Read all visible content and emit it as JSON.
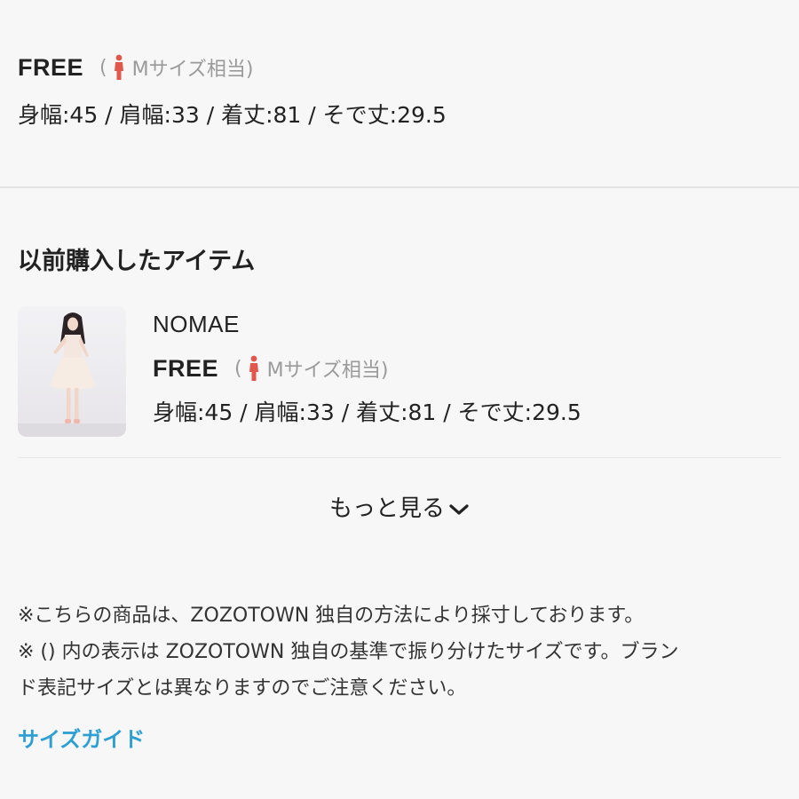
{
  "top_size": {
    "name": "FREE",
    "open_paren": "(",
    "equivalent": "Mサイズ相当)",
    "measurements": "身幅:45 / 肩幅:33 / 着丈:81 / そで丈:29.5"
  },
  "purchased": {
    "title": "以前購入したアイテム",
    "items": [
      {
        "brand": "NOMAE",
        "size_name": "FREE",
        "open_paren": "(",
        "equivalent": "Mサイズ相当)",
        "measurements": "身幅:45 / 肩幅:33 / 着丈:81 / そで丈:29.5"
      }
    ]
  },
  "more_label": "もっと見る",
  "notes": {
    "line1": "※こちらの商品は、ZOZOTOWN 独自の方法により採寸しております。",
    "line2": "※ () 内の表示は ZOZOTOWN 独自の基準で振り分けたサイズです。ブラン",
    "line3": "ド表記サイズとは異なりますのでご注意ください。"
  },
  "size_guide_link": "サイズガイド",
  "colors": {
    "person_icon": "#e2574c",
    "link": "#2d9fd2",
    "background": "#f7f7f7"
  },
  "icons": {
    "size_person": "person-icon",
    "more": "chevron-down-icon"
  }
}
